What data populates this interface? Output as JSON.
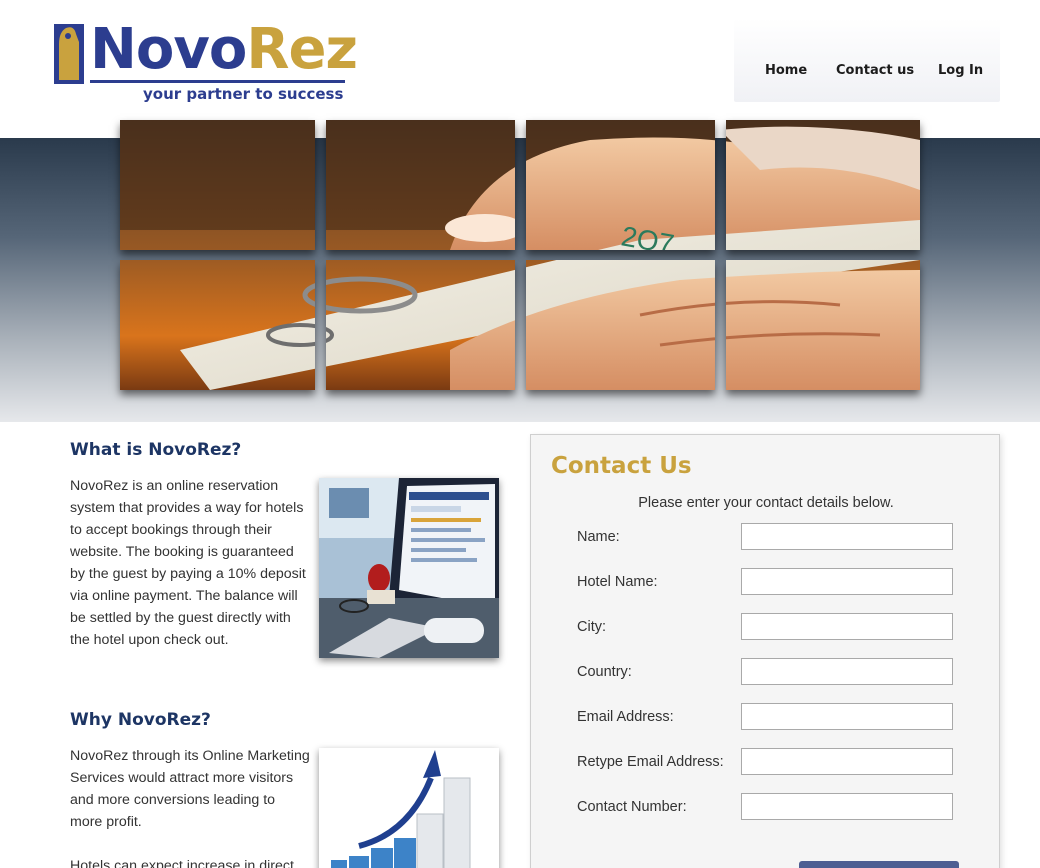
{
  "header": {
    "logo_novo": "Novo",
    "logo_rez": "Rez",
    "logo_tagline": "your partner to success",
    "brand_colors": {
      "navy": "#2c3d8f",
      "gold": "#c9a23e"
    }
  },
  "nav": {
    "items": [
      {
        "label": "Home"
      },
      {
        "label": "Contact us"
      },
      {
        "label": "Log In"
      }
    ]
  },
  "banner": {
    "image": "hand-holding-hotel-keycard"
  },
  "what_is": {
    "title": "What is NovoRez?",
    "text": "NovoRez is an online reservation system that provides a way for hotels to accept bookings through their website. The booking is guaranteed by the guest by paying a 10% deposit via online payment. The balance will be settled by the guest directly with the hotel upon check out.",
    "image": "computer-screen-reservation-site"
  },
  "why": {
    "title": "Why NovoRez?",
    "text": "NovoRez through its Online Marketing Services would attract more visitors and more conversions leading to more profit.",
    "text2": "Hotels can expect increase in direct",
    "image": "growth-bar-chart-arrow"
  },
  "contact": {
    "title": "Contact Us",
    "intro": "Please enter your contact details below.",
    "fields": [
      {
        "label": "Name:",
        "value": ""
      },
      {
        "label": "Hotel Name:",
        "value": ""
      },
      {
        "label": "City:",
        "value": ""
      },
      {
        "label": "Country:",
        "value": ""
      },
      {
        "label": "Email Address:",
        "value": ""
      },
      {
        "label": "Retype Email Address:",
        "value": ""
      },
      {
        "label": "Contact Number:",
        "value": ""
      }
    ]
  }
}
